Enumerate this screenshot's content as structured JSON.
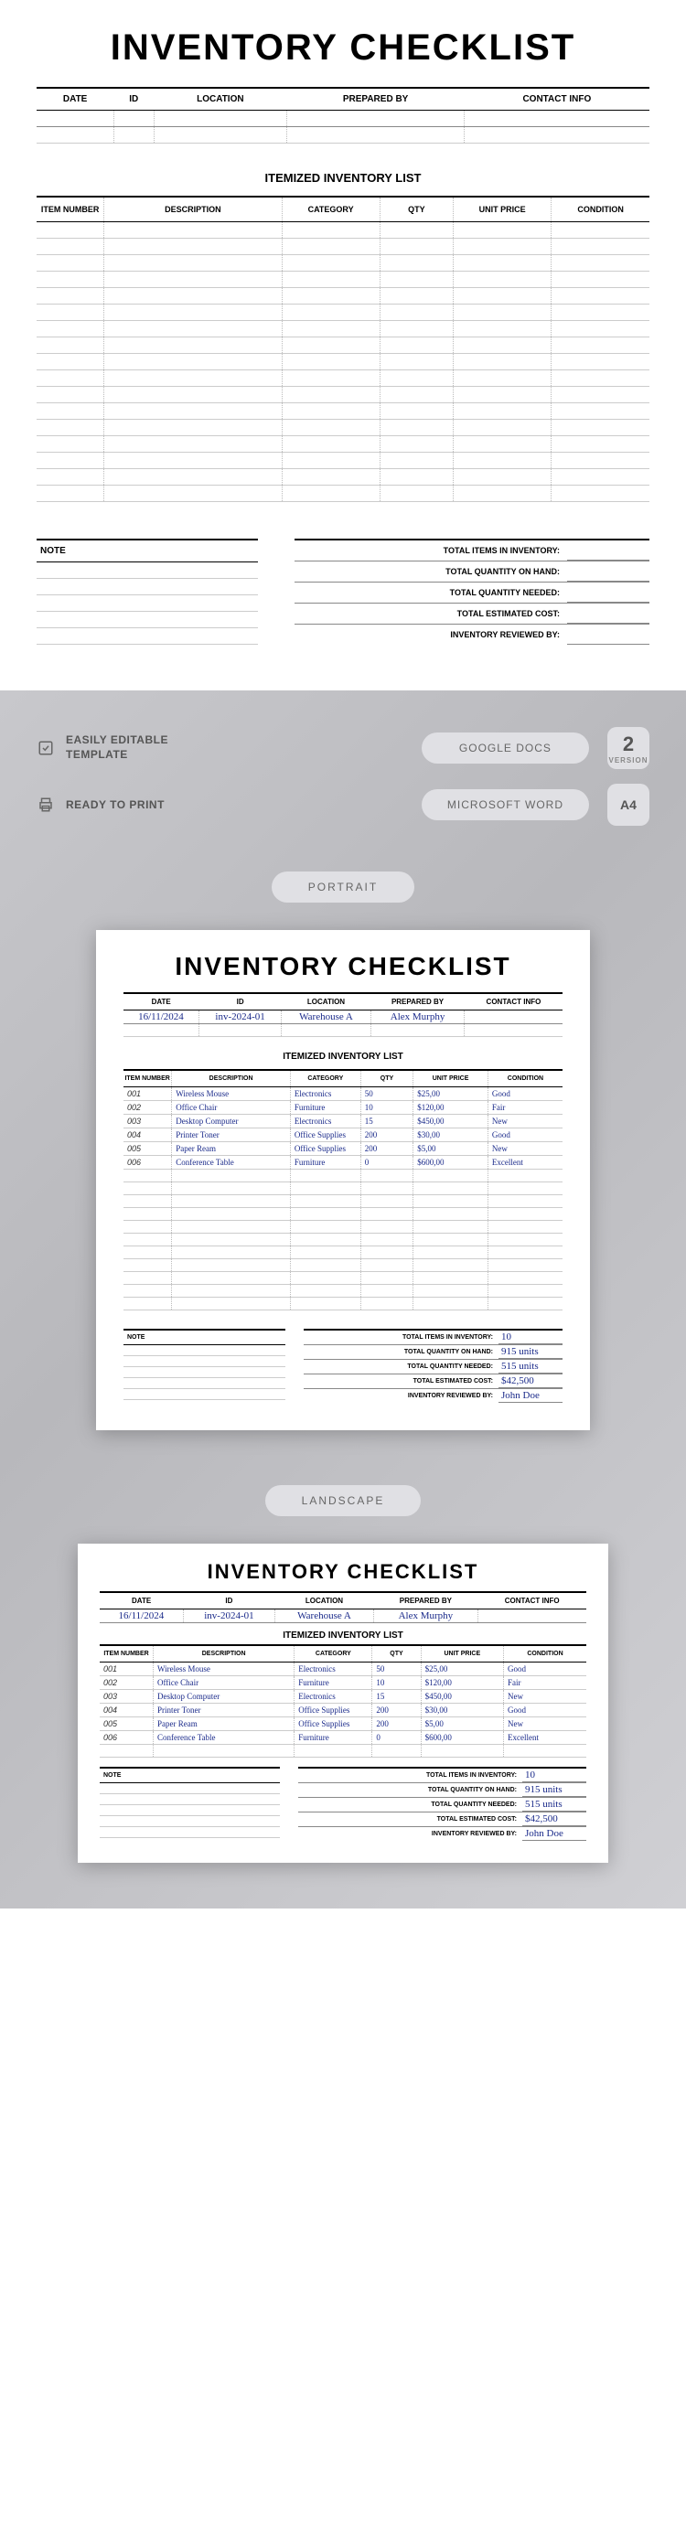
{
  "template": {
    "title": "INVENTORY CHECKLIST",
    "meta_headers": [
      "DATE",
      "ID",
      "LOCATION",
      "PREPARED BY",
      "CONTACT INFO"
    ],
    "section_title": "ITEMIZED INVENTORY LIST",
    "item_headers": [
      "ITEM NUMBER",
      "DESCRIPTION",
      "CATEGORY",
      "QTY",
      "UNIT PRICE",
      "CONDITION"
    ],
    "note_label": "NOTE",
    "totals": [
      "TOTAL ITEMS IN INVENTORY:",
      "TOTAL QUANTITY ON HAND:",
      "TOTAL QUANTITY NEEDED:",
      "TOTAL ESTIMATED COST:",
      "INVENTORY REVIEWED BY:"
    ]
  },
  "features": {
    "editable": "EASILY EDITABLE TEMPLATE",
    "print": "READY TO PRINT",
    "gdocs": "GOOGLE DOCS",
    "word": "MICROSOFT WORD",
    "versions": "2",
    "versions_sub": "VERSION",
    "a4": "A4",
    "portrait": "PORTRAIT",
    "landscape": "LANDSCAPE"
  },
  "sample": {
    "meta": {
      "date": "16/11/2024",
      "id": "inv-2024-01",
      "location": "Warehouse A",
      "prepared_by": "Alex Murphy",
      "contact": ""
    },
    "items": [
      {
        "num": "001",
        "desc": "Wireless Mouse",
        "cat": "Electronics",
        "qty": "50",
        "price": "$25,00",
        "cond": "Good"
      },
      {
        "num": "002",
        "desc": "Office Chair",
        "cat": "Furniture",
        "qty": "10",
        "price": "$120,00",
        "cond": "Fair"
      },
      {
        "num": "003",
        "desc": "Desktop Computer",
        "cat": "Electronics",
        "qty": "15",
        "price": "$450,00",
        "cond": "New"
      },
      {
        "num": "004",
        "desc": "Printer Toner",
        "cat": "Office Supplies",
        "qty": "200",
        "price": "$30,00",
        "cond": "Good"
      },
      {
        "num": "005",
        "desc": "Paper Ream",
        "cat": "Office Supplies",
        "qty": "200",
        "price": "$5,00",
        "cond": "New"
      },
      {
        "num": "006",
        "desc": "Conference Table",
        "cat": "Furniture",
        "qty": "0",
        "price": "$600,00",
        "cond": "Excellent"
      }
    ],
    "totals": {
      "items": "10",
      "on_hand": "915 units",
      "needed": "515 units",
      "cost": "$42,500",
      "reviewed": "John Doe"
    }
  }
}
